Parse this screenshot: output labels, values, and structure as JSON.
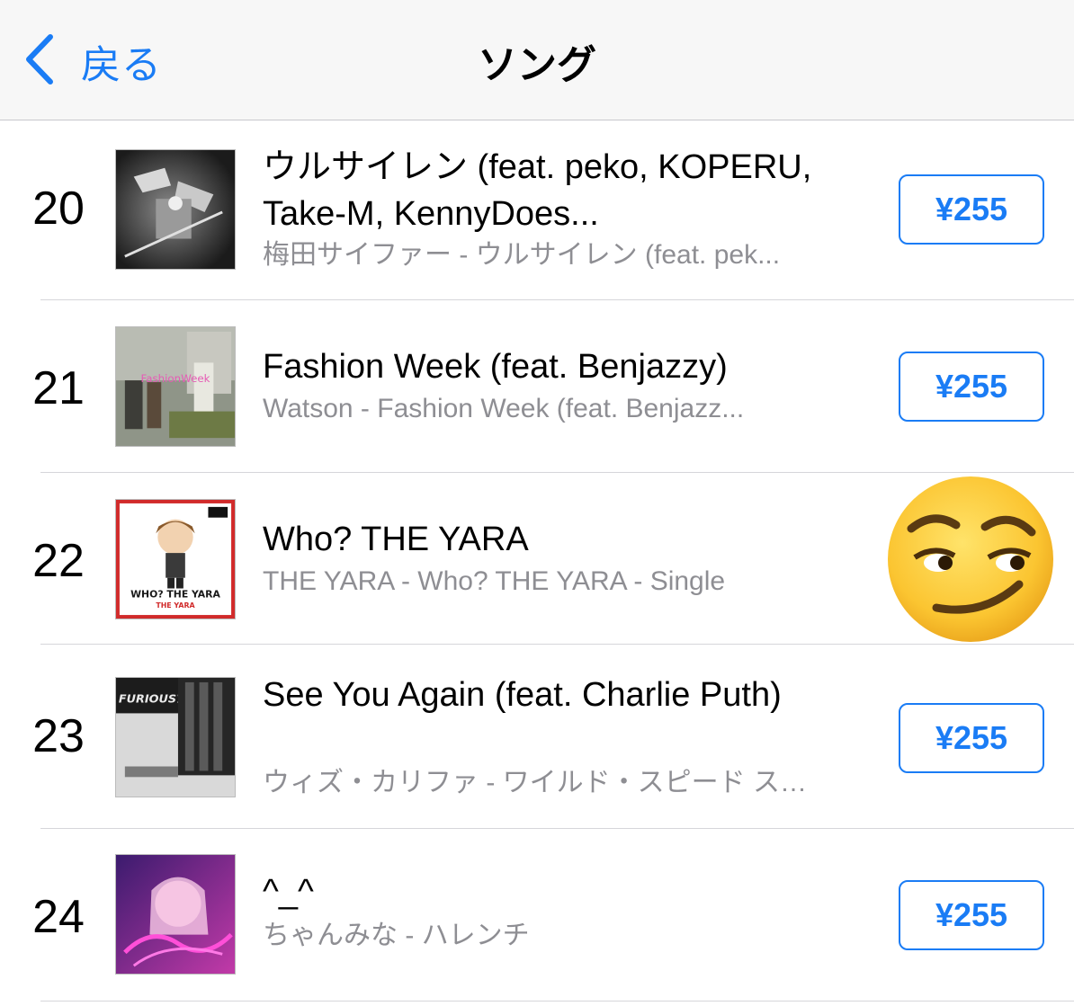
{
  "nav": {
    "back_label": "戻る",
    "title": "ソング"
  },
  "songs": [
    {
      "rank": "20",
      "title": "ウルサイレン (feat. peko, KOPERU, Take-M, KennyDoes...",
      "subtitle": "梅田サイファー - ウルサイレン (feat. pek...",
      "price": "¥255",
      "art": "dark-mech-icon"
    },
    {
      "rank": "21",
      "title": "Fashion Week (feat. Benjazzy)",
      "subtitle": "Watson - Fashion Week (feat. Benjazz...",
      "price": "¥255",
      "art": "street-photo-icon",
      "art_text": "FashionWeek"
    },
    {
      "rank": "22",
      "title": "Who? THE YARA",
      "subtitle": "THE YARA - Who? THE YARA - Single",
      "price": null,
      "art": "cartoon-character-icon",
      "art_text": "WHO? THE YARA",
      "art_subtext": "THE YARA"
    },
    {
      "rank": "23",
      "title": "See You Again (feat. Charlie Puth)",
      "subtitle": "ウィズ・カリファ - ワイルド・スピード ス…",
      "price": "¥255",
      "art": "car-wheel-icon",
      "art_text": "FURIOUS7"
    },
    {
      "rank": "24",
      "title": "^_^",
      "subtitle": "ちゃんみな - ハレンチ",
      "price": "¥255",
      "art": "neon-portrait-icon"
    }
  ],
  "overlay": {
    "emoji": "smirking-face-icon"
  },
  "colors": {
    "accent": "#1a7cf5",
    "secondary_text": "#8e8e93",
    "navbar_bg": "#f7f7f7",
    "divider": "#d6d6da"
  }
}
